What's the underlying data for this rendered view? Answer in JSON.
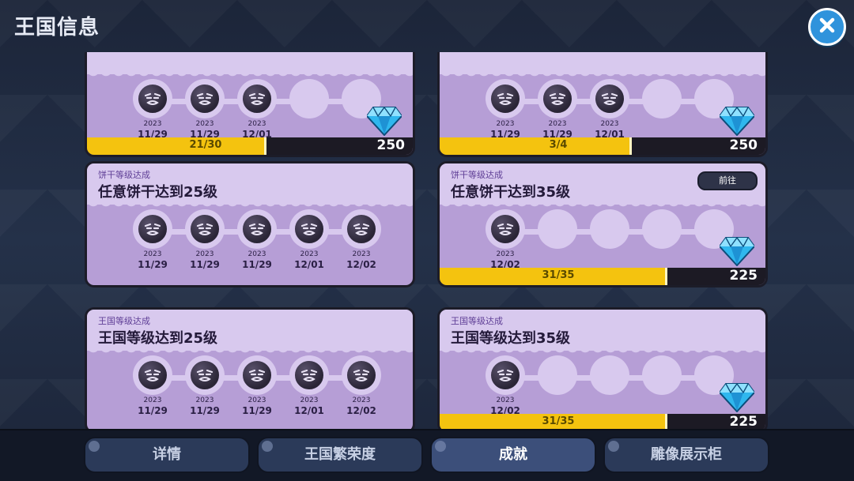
{
  "header": {
    "title": "王国信息"
  },
  "icons": {
    "close": "close-icon",
    "badge": "cookie-face-badge-icon",
    "reward": "crystal-gem-icon"
  },
  "colors": {
    "progress": "#f4c30f",
    "card": "#b69ed6",
    "gem": "#2fb7ee"
  },
  "cards": [
    {
      "category": "",
      "name": "",
      "go_label": "",
      "milestones": [
        {
          "year": "2023",
          "date": "11/29",
          "done": true
        },
        {
          "year": "2023",
          "date": "11/29",
          "done": true
        },
        {
          "year": "2023",
          "date": "12/01",
          "done": true
        },
        {
          "year": "",
          "date": "",
          "done": false
        },
        {
          "year": "",
          "date": "",
          "done": false
        }
      ],
      "progress_text": "21/30",
      "progress_fraction": 0.7,
      "reward": "250"
    },
    {
      "category": "",
      "name": "",
      "go_label": "",
      "milestones": [
        {
          "year": "2023",
          "date": "11/29",
          "done": true
        },
        {
          "year": "2023",
          "date": "11/29",
          "done": true
        },
        {
          "year": "2023",
          "date": "12/01",
          "done": true
        },
        {
          "year": "",
          "date": "",
          "done": false
        },
        {
          "year": "",
          "date": "",
          "done": false
        }
      ],
      "progress_text": "3/4",
      "progress_fraction": 0.75,
      "reward": "250"
    },
    {
      "category": "饼干等级达成",
      "name": "任意饼干达到25级",
      "go_label": "",
      "milestones": [
        {
          "year": "2023",
          "date": "11/29",
          "done": true
        },
        {
          "year": "2023",
          "date": "11/29",
          "done": true
        },
        {
          "year": "2023",
          "date": "11/29",
          "done": true
        },
        {
          "year": "2023",
          "date": "12/01",
          "done": true
        },
        {
          "year": "2023",
          "date": "12/02",
          "done": true
        }
      ],
      "progress_text": "",
      "progress_fraction": null,
      "reward": ""
    },
    {
      "category": "饼干等级达成",
      "name": "任意饼干达到35级",
      "go_label": "前往",
      "milestones": [
        {
          "year": "2023",
          "date": "12/02",
          "done": true
        },
        {
          "year": "",
          "date": "",
          "done": false
        },
        {
          "year": "",
          "date": "",
          "done": false
        },
        {
          "year": "",
          "date": "",
          "done": false
        },
        {
          "year": "",
          "date": "",
          "done": false
        }
      ],
      "progress_text": "31/35",
      "progress_fraction": 0.89,
      "reward": "225"
    },
    {
      "category": "王国等级达成",
      "name": "王国等级达到25级",
      "go_label": "",
      "milestones": [
        {
          "year": "2023",
          "date": "11/29",
          "done": true
        },
        {
          "year": "2023",
          "date": "11/29",
          "done": true
        },
        {
          "year": "2023",
          "date": "11/29",
          "done": true
        },
        {
          "year": "2023",
          "date": "12/01",
          "done": true
        },
        {
          "year": "2023",
          "date": "12/02",
          "done": true
        }
      ],
      "progress_text": "",
      "progress_fraction": null,
      "reward": ""
    },
    {
      "category": "王国等级达成",
      "name": "王国等级达到35级",
      "go_label": "",
      "milestones": [
        {
          "year": "2023",
          "date": "12/02",
          "done": true
        },
        {
          "year": "",
          "date": "",
          "done": false
        },
        {
          "year": "",
          "date": "",
          "done": false
        },
        {
          "year": "",
          "date": "",
          "done": false
        },
        {
          "year": "",
          "date": "",
          "done": false
        }
      ],
      "progress_text": "31/35",
      "progress_fraction": 0.89,
      "reward": "225"
    }
  ],
  "tabs": [
    {
      "label": "详情",
      "active": false
    },
    {
      "label": "王国繁荣度",
      "active": false
    },
    {
      "label": "成就",
      "active": true
    },
    {
      "label": "雕像展示柜",
      "active": false
    }
  ]
}
